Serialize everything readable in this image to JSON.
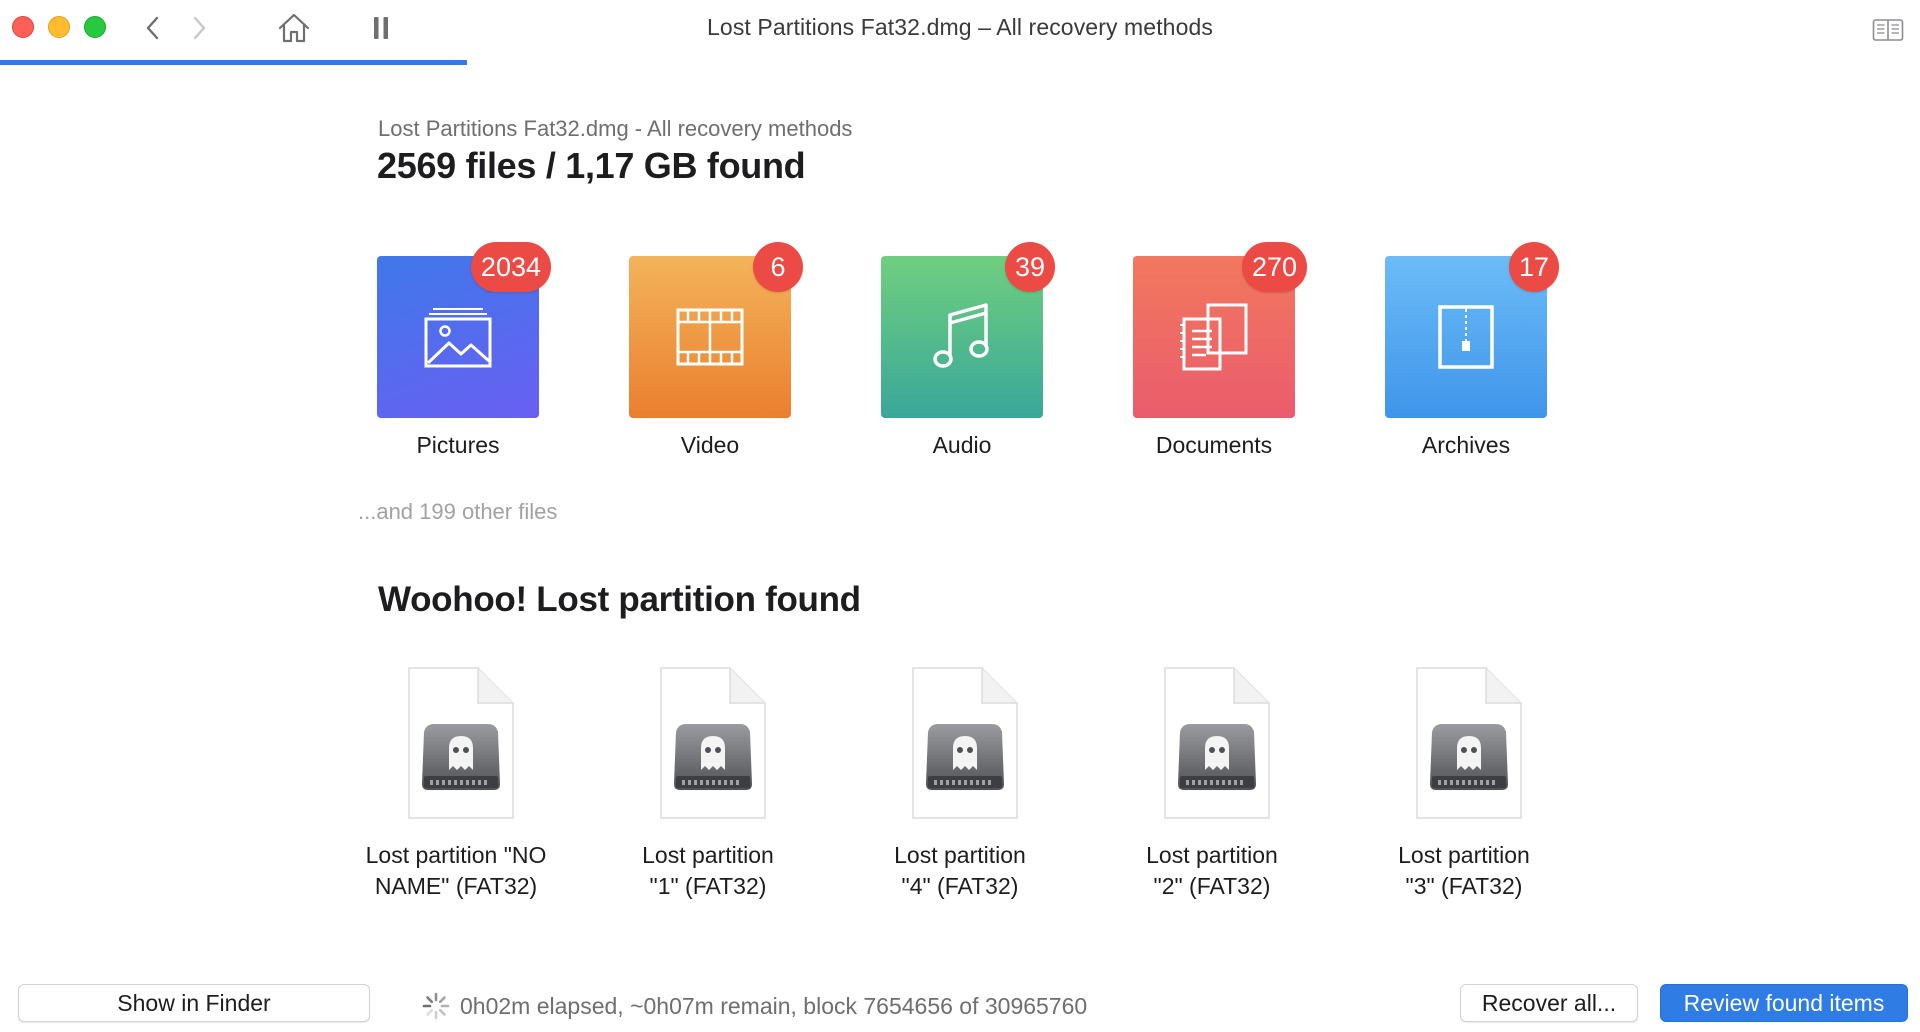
{
  "window": {
    "title": "Lost Partitions Fat32.dmg – All recovery methods",
    "scan_progress_percent": 24.3
  },
  "header": {
    "subtitle": "Lost Partitions Fat32.dmg - All recovery methods",
    "headline": "2569 files / 1,17 GB found"
  },
  "categories": [
    {
      "label": "Pictures",
      "count": "2034",
      "icon": "picture-icon"
    },
    {
      "label": "Video",
      "count": "6",
      "icon": "film-icon"
    },
    {
      "label": "Audio",
      "count": "39",
      "icon": "music-note-icon"
    },
    {
      "label": "Documents",
      "count": "270",
      "icon": "documents-icon"
    },
    {
      "label": "Archives",
      "count": "17",
      "icon": "archive-zip-icon"
    }
  ],
  "other_files": "...and 199 other files",
  "partitions": {
    "title": "Woohoo! Lost partition found",
    "items": [
      {
        "line1": "Lost partition \"NO",
        "line2": "NAME\" (FAT32)"
      },
      {
        "line1": "Lost partition",
        "line2": "\"1\" (FAT32)"
      },
      {
        "line1": "Lost partition",
        "line2": "\"4\" (FAT32)"
      },
      {
        "line1": "Lost partition",
        "line2": "\"2\" (FAT32)"
      },
      {
        "line1": "Lost partition",
        "line2": "\"3\" (FAT32)"
      }
    ]
  },
  "footer": {
    "show_in_finder": "Show in Finder",
    "status": "0h02m elapsed, ~0h07m remain, block 7654656 of 30965760",
    "recover_all": "Recover all...",
    "review": "Review found items"
  },
  "colors": {
    "accent": "#2f7ce5",
    "badge": "#ec4a45"
  }
}
